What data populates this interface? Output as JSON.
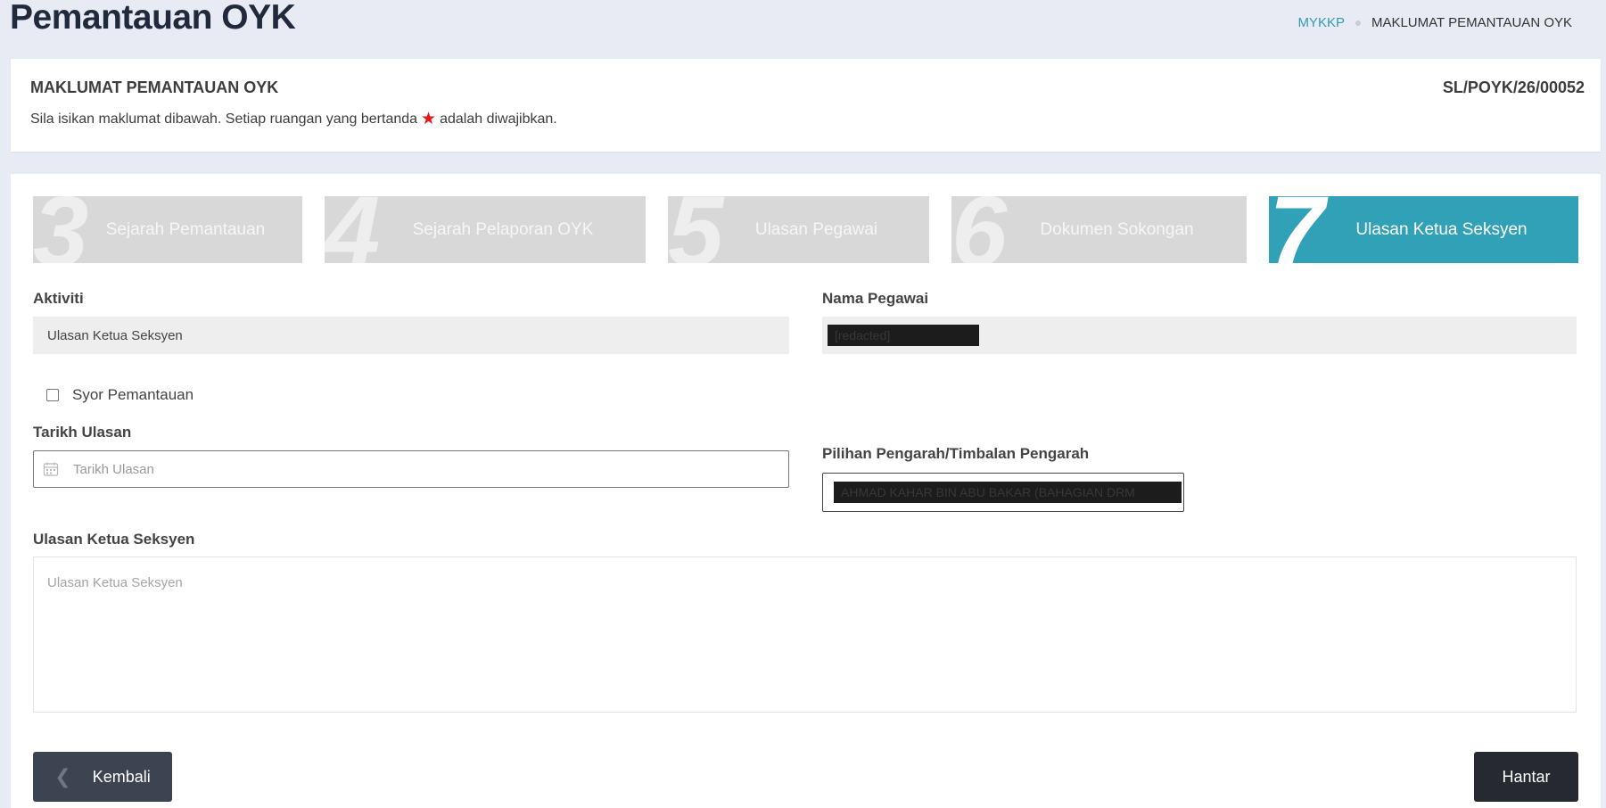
{
  "header": {
    "title": "Pemantauan OYK",
    "breadcrumb": {
      "link": "MYKKP",
      "current": "MAKLUMAT PEMANTAUAN OYK"
    }
  },
  "info": {
    "title": "MAKLUMAT PEMANTAUAN OYK",
    "reference_no": "SL/POYK/26/00052",
    "desc_before": "Sila isikan maklumat dibawah. Setiap ruangan yang bertanda",
    "desc_after": "adalah diwajibkan.",
    "required_icon": "star-icon",
    "required_color": "#e5161c"
  },
  "steps": [
    {
      "num": "3",
      "label": "Sejarah Pemantauan",
      "active": false
    },
    {
      "num": "4",
      "label": "Sejarah Pelaporan OYK",
      "active": false
    },
    {
      "num": "5",
      "label": "Ulasan Pegawai",
      "active": false
    },
    {
      "num": "6",
      "label": "Dokumen Sokongan",
      "active": false
    },
    {
      "num": "7",
      "label": "Ulasan Ketua Seksyen",
      "active": true
    }
  ],
  "form": {
    "aktiviti_label": "Aktiviti",
    "aktiviti_value": "Ulasan Ketua Seksyen",
    "nama_pegawai_label": "Nama Pegawai",
    "nama_pegawai_value": "[redacted]",
    "syor_label": "Syor Pemantauan",
    "syor_checked": false,
    "tarikh_label": "Tarikh Ulasan",
    "tarikh_placeholder": "Tarikh Ulasan",
    "pengarah_label": "Pilihan Pengarah/Timbalan Pengarah",
    "pengarah_value": "AHMAD KAHAR BIN ABU BAKAR (BAHAGIAN DRM",
    "ulasan_label": "Ulasan Ketua Seksyen",
    "ulasan_placeholder": "Ulasan Ketua Seksyen"
  },
  "buttons": {
    "back": "Kembali",
    "submit": "Hantar"
  },
  "colors": {
    "accent": "#31a1b7",
    "step_inactive": "#d8d8d8",
    "back_btn": "#3c4452",
    "submit_btn": "#262a30"
  }
}
